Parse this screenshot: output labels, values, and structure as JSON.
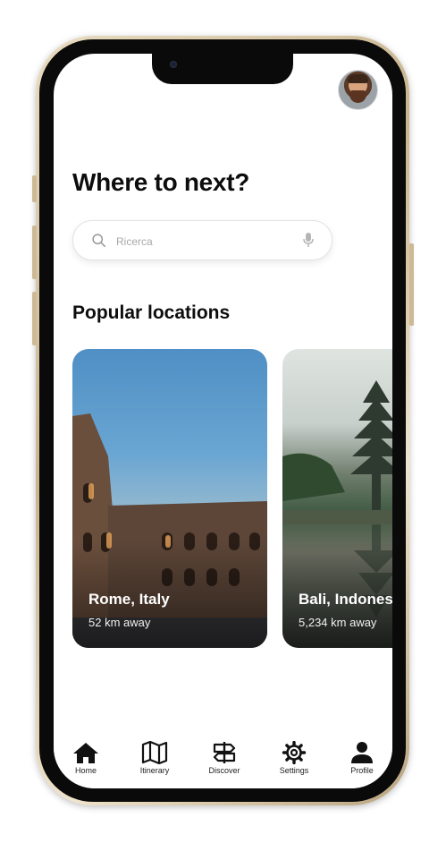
{
  "header": {
    "title": "Where to next?"
  },
  "search": {
    "placeholder": "Ricerca"
  },
  "section": {
    "title": "Popular locations"
  },
  "locations": [
    {
      "name": "Rome, Italy",
      "distance": "52 km away"
    },
    {
      "name": "Bali, Indonesia",
      "distance": "5,234 km away"
    }
  ],
  "tabs": [
    {
      "label": "Home",
      "icon": "home-icon"
    },
    {
      "label": "Itinerary",
      "icon": "map-icon"
    },
    {
      "label": "Discover",
      "icon": "signpost-icon"
    },
    {
      "label": "Settings",
      "icon": "gear-icon"
    },
    {
      "label": "Profile",
      "icon": "person-icon"
    }
  ],
  "colors": {
    "text": "#0d0d0d",
    "frame": "#c9b48e"
  }
}
